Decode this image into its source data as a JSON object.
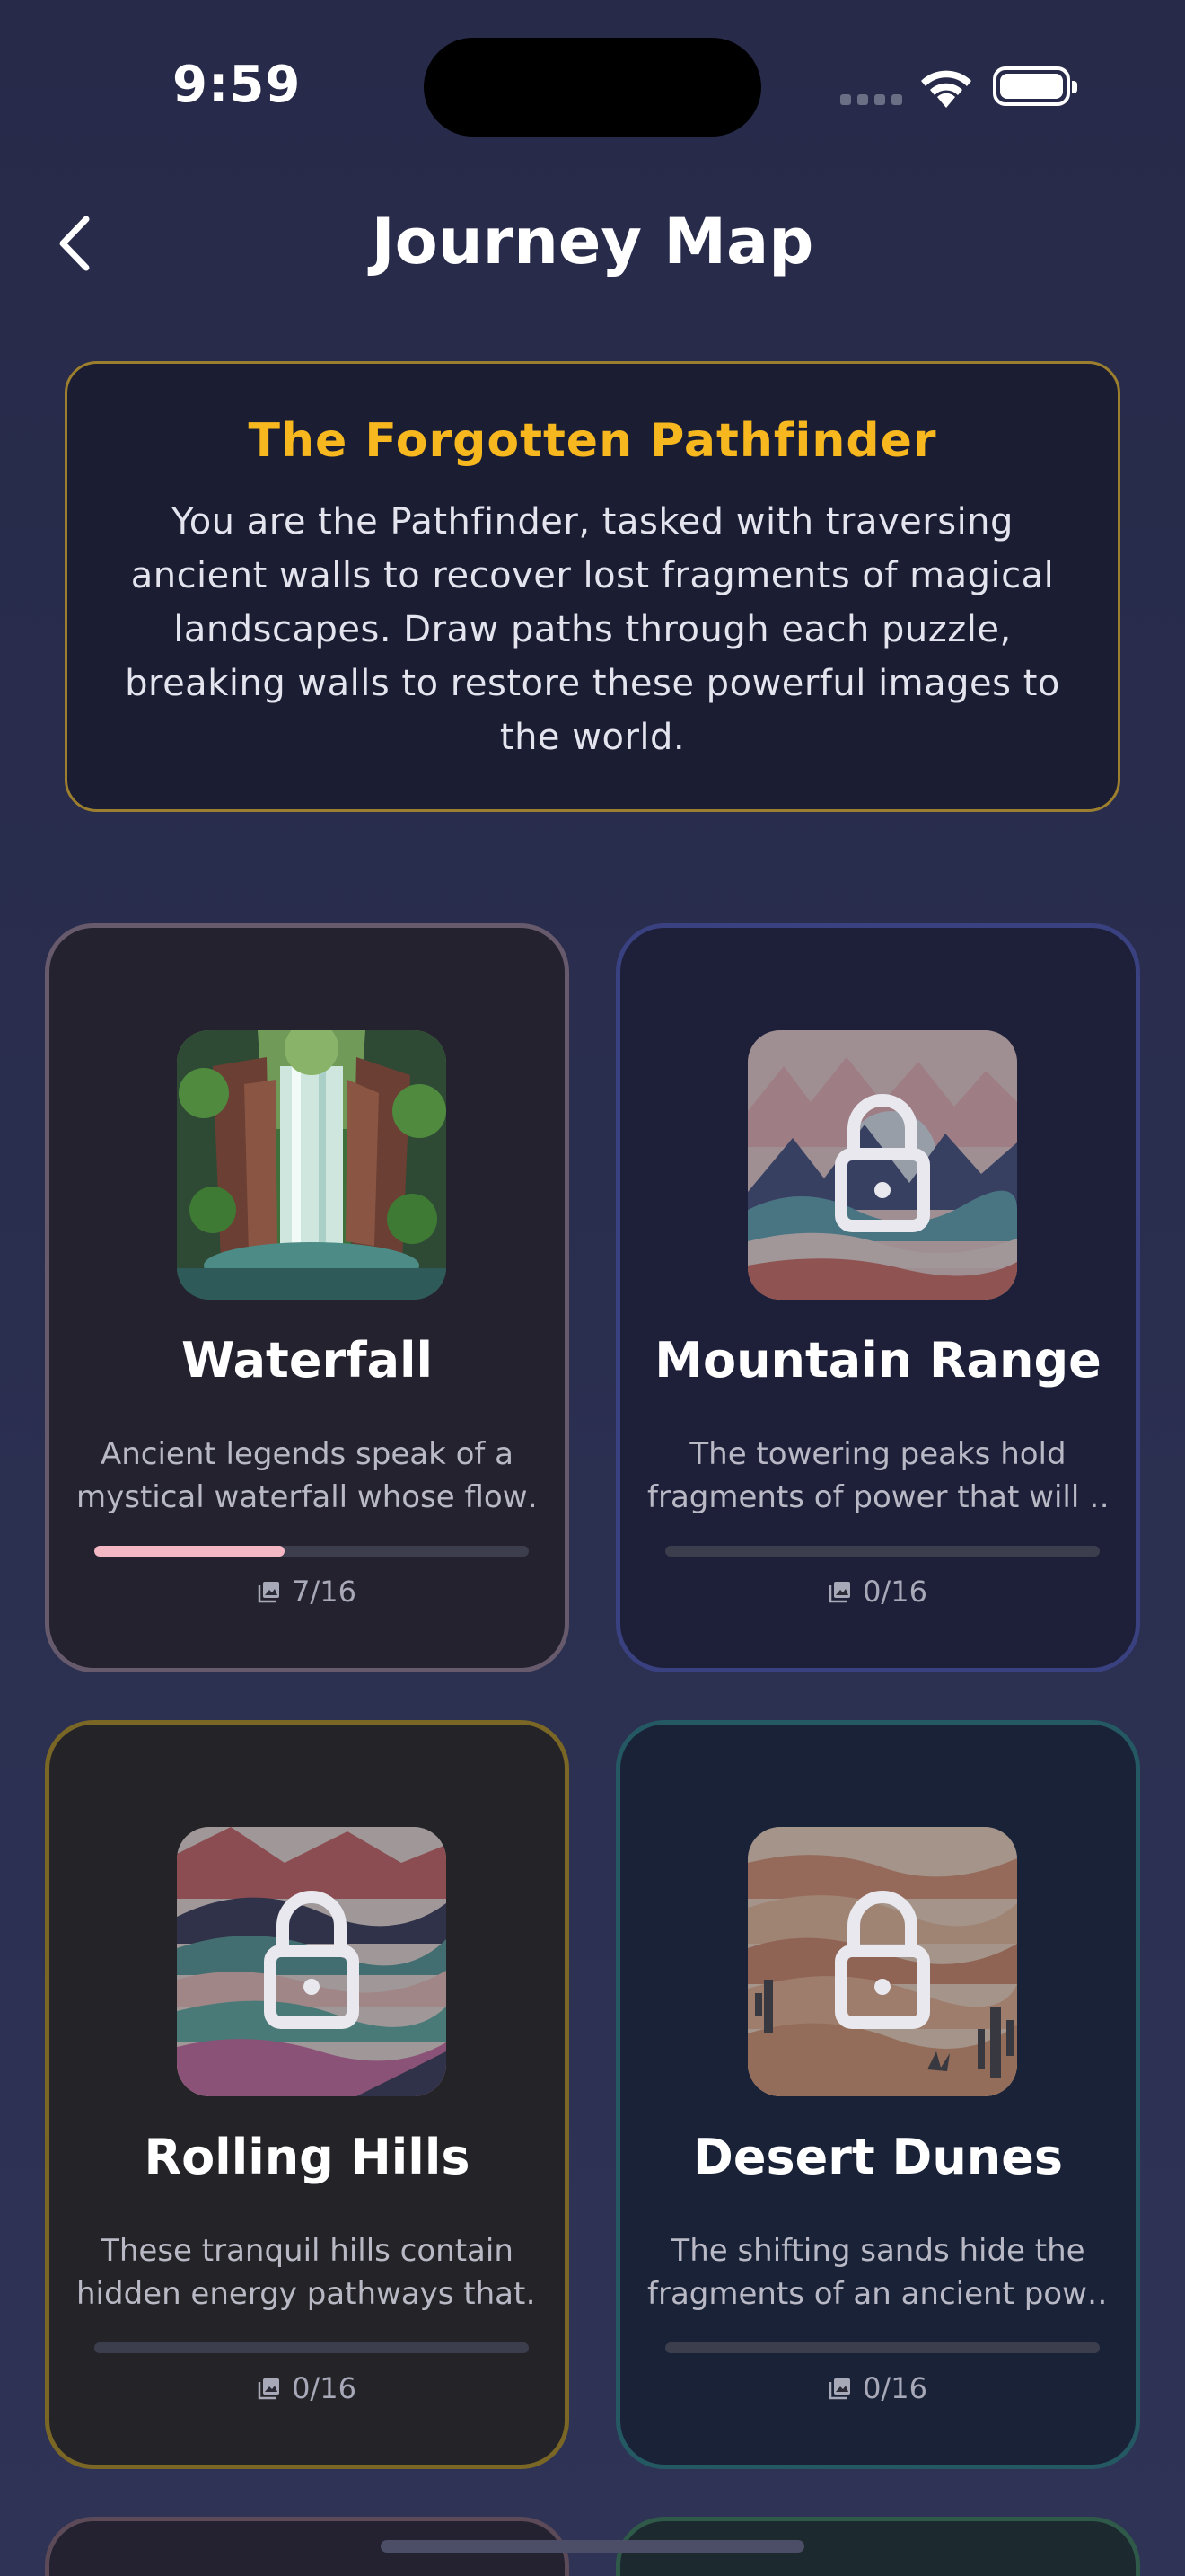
{
  "status_bar": {
    "time": "9:59"
  },
  "header": {
    "title": "Journey Map"
  },
  "story": {
    "title": "The Forgotten Pathfinder",
    "lines": [
      "You are the Pathfinder, tasked with traversing",
      "ancient walls to recover lost fragments of magical",
      "landscapes. Draw paths through each puzzle,",
      "breaking walls to restore these powerful images to",
      "the world."
    ]
  },
  "levels": [
    {
      "name": "Waterfall",
      "desc_lines": [
        "Ancient legends speak of a",
        "mystical waterfall whose flow…"
      ],
      "progress_label": "7/16",
      "progress_fraction": 0.4375,
      "locked": false,
      "border_color": "#675a6c",
      "bg_color": "#24222f"
    },
    {
      "name": "Mountain Range",
      "desc_lines": [
        "The towering peaks hold",
        "fragments of power that will …"
      ],
      "progress_label": "0/16",
      "progress_fraction": 0,
      "locked": true,
      "border_color": "#3a4180",
      "bg_color": "#1e2039"
    },
    {
      "name": "Rolling Hills",
      "desc_lines": [
        "These tranquil hills contain",
        "hidden energy pathways that…"
      ],
      "progress_label": "0/16",
      "progress_fraction": 0,
      "locked": true,
      "border_color": "#7a6625",
      "bg_color": "#242428"
    },
    {
      "name": "Desert Dunes",
      "desc_lines": [
        "The shifting sands hide the",
        "fragments of an ancient pow…"
      ],
      "progress_label": "0/16",
      "progress_fraction": 0,
      "locked": true,
      "border_color": "#245863",
      "bg_color": "#1a2238"
    }
  ],
  "colors": {
    "accent_gold": "#f6b81e",
    "progress_pink": "#f4b8c4",
    "background": "#2a2d4d"
  },
  "icons": {
    "back": "chevron-left-icon",
    "progress": "image-stack-icon",
    "lock": "lock-icon"
  }
}
